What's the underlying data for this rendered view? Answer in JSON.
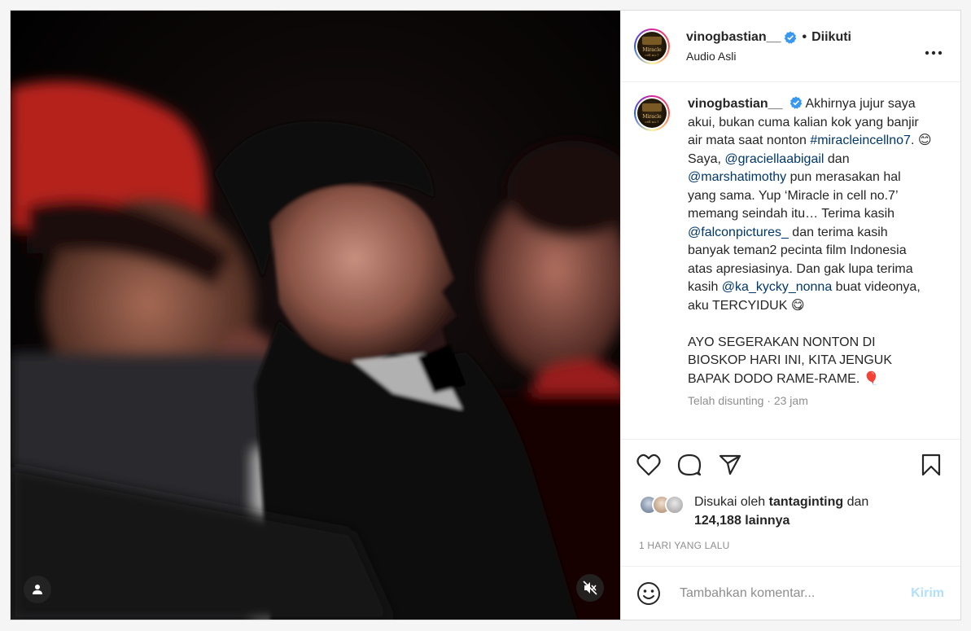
{
  "header": {
    "username": "vinogbastian__",
    "dot": "•",
    "follow_state": "Diikuti",
    "audio": "Audio Asli",
    "avatar_text": "Miracle in Cell No.7"
  },
  "caption": {
    "username": "vinogbastian__",
    "segments": [
      {
        "text": "Akhirnya jujur saya akui, bukan cuma kalian kok yang banjir air mata saat nonton ",
        "type": "text"
      },
      {
        "text": "#miracleincellno7",
        "type": "link"
      },
      {
        "text": ". 😊\nSaya, ",
        "type": "text"
      },
      {
        "text": "@graciellaabigail",
        "type": "link"
      },
      {
        "text": " dan ",
        "type": "text"
      },
      {
        "text": "@marshatimothy",
        "type": "link"
      },
      {
        "text": " pun merasakan hal yang sama. Yup ‘Miracle in cell no.7’ memang seindah itu… Terima kasih ",
        "type": "text"
      },
      {
        "text": "@falconpictures_",
        "type": "link"
      },
      {
        "text": " dan terima kasih banyak teman2 pecinta film Indonesia atas apresiasinya. Dan gak lupa terima kasih ",
        "type": "text"
      },
      {
        "text": "@ka_kycky_nonna",
        "type": "link"
      },
      {
        "text": " buat videonya, aku TERCYIDUK 😋\n\nAYO SEGERAKAN NONTON DI BIOSKOP HARI INI, KITA JENGUK BAPAK DODO RAME-RAME. 🎈",
        "type": "text"
      }
    ],
    "edited": "Telah disunting · 23 jam"
  },
  "likes": {
    "prefix": "Disukai oleh ",
    "user": "tantaginting",
    "and": " dan",
    "count": "124,188 lainnya"
  },
  "time_ago": "1 HARI YANG LALU",
  "comment": {
    "placeholder": "Tambahkan komentar...",
    "post_label": "Kirim"
  },
  "icons": {
    "like": "heart-icon",
    "comment": "comment-icon",
    "share": "share-icon",
    "save": "bookmark-icon",
    "more": "more-icon",
    "tag": "user-tag-icon",
    "mute": "muted-speaker-icon",
    "emoji": "emoji-icon",
    "verified": "verified-badge-icon"
  },
  "colors": {
    "link": "#00376b",
    "verified": "#3897f0",
    "post_button_disabled": "#b2dffc"
  }
}
